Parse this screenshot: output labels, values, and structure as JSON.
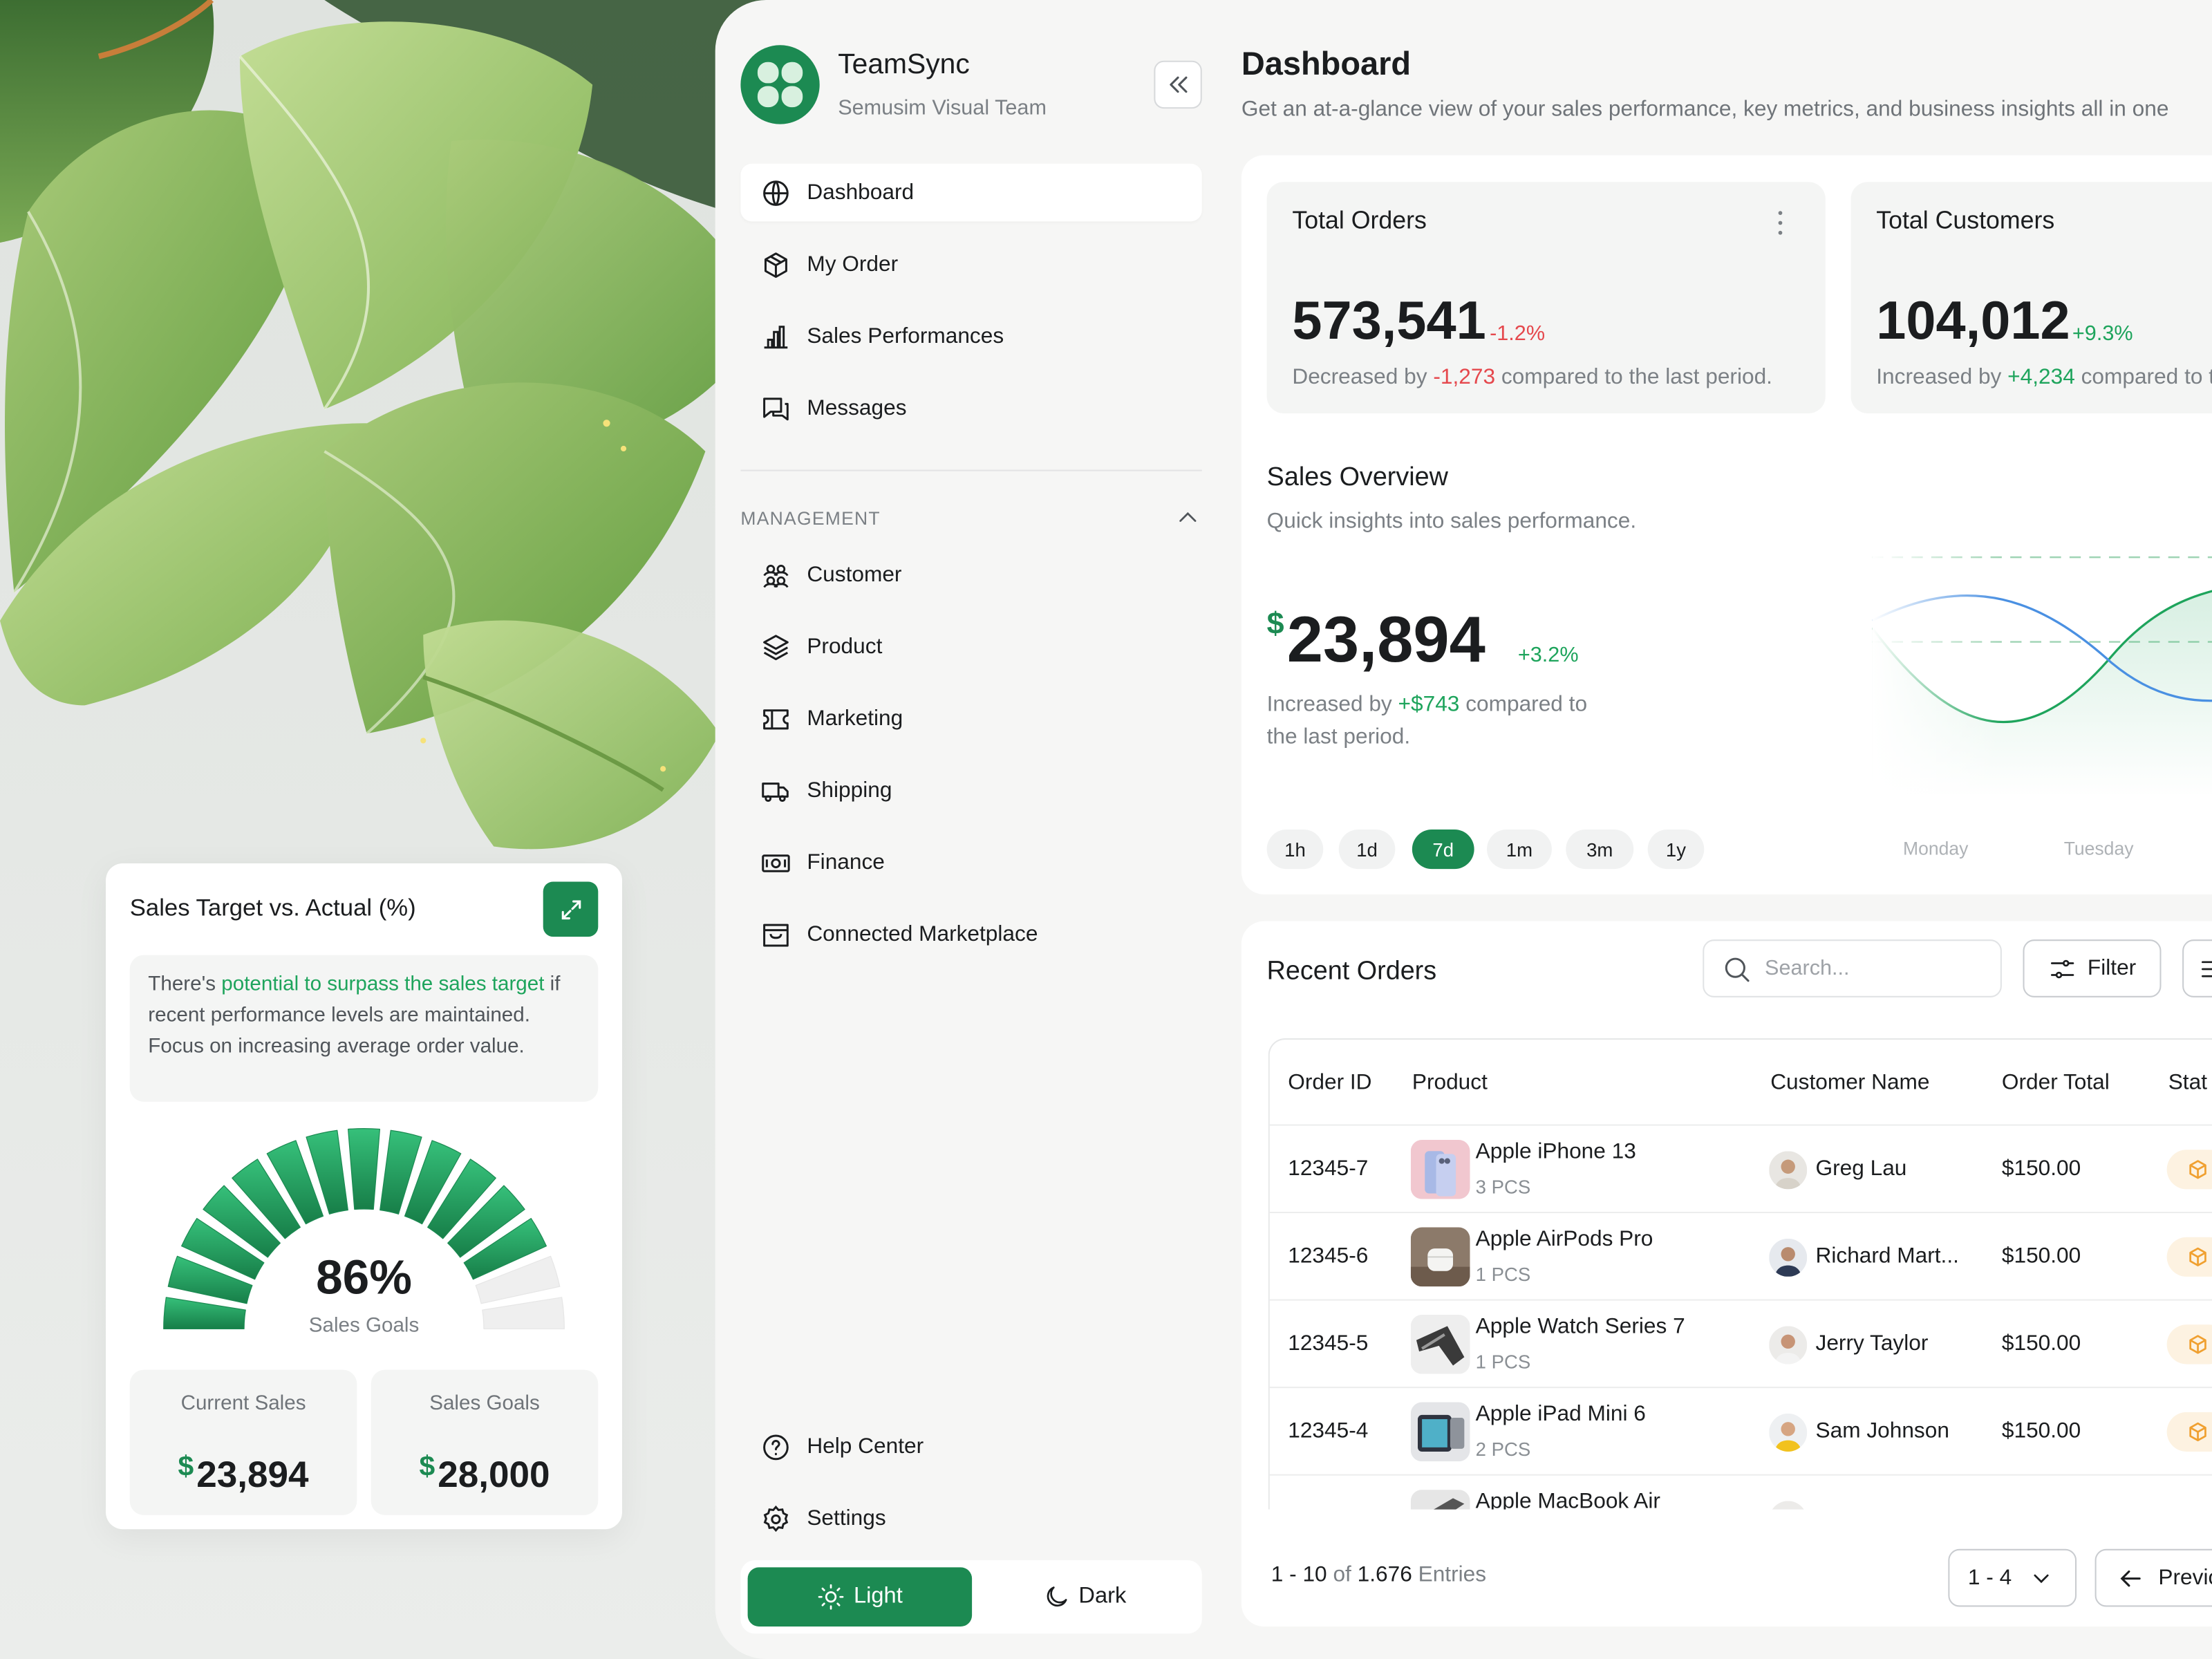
{
  "sales_target_card": {
    "title": "Sales Target vs. Actual (%)",
    "insight_prefix": "There's ",
    "insight_highlight": "potential to surpass the sales target",
    "insight_suffix": " if recent performance levels are maintained. Focus on increasing average order value.",
    "gauge_value": "86%",
    "gauge_percent": 86,
    "gauge_label": "Sales Goals",
    "current_sales_label": "Current Sales",
    "current_sales_currency": "$",
    "current_sales_value": "23,894",
    "sales_goals_label": "Sales Goals",
    "sales_goals_currency": "$",
    "sales_goals_value": "28,000"
  },
  "sidebar": {
    "brand_name": "TeamSync",
    "team_name": "Semusim Visual Team",
    "nav_items": [
      {
        "label": "Dashboard",
        "icon": "globe-icon",
        "active": true
      },
      {
        "label": "My Order",
        "icon": "box-icon"
      },
      {
        "label": "Sales Performances",
        "icon": "bar-chart-icon"
      },
      {
        "label": "Messages",
        "icon": "chat-icon"
      }
    ],
    "section_label": "MANAGEMENT",
    "management_items": [
      {
        "label": "Customer",
        "icon": "users-icon"
      },
      {
        "label": "Product",
        "icon": "layers-icon"
      },
      {
        "label": "Marketing",
        "icon": "ticket-icon"
      },
      {
        "label": "Shipping",
        "icon": "truck-icon"
      },
      {
        "label": "Finance",
        "icon": "money-icon"
      },
      {
        "label": "Connected Marketplace",
        "icon": "store-icon"
      }
    ],
    "help_label": "Help Center",
    "settings_label": "Settings",
    "theme_light": "Light",
    "theme_dark": "Dark"
  },
  "header": {
    "title": "Dashboard",
    "subtitle": "Get an at-a-glance view of your sales performance, key metrics, and business insights all in one"
  },
  "kpis": [
    {
      "title": "Total Orders",
      "value": "573,541",
      "change": "-1.2%",
      "desc_prefix": "Decreased by ",
      "desc_amount": "-1,273",
      "desc_suffix": " compared to the last period."
    },
    {
      "title": "Total Customers",
      "value": "104,012",
      "change": "+9.3%",
      "desc_prefix": "Increased by ",
      "desc_amount": "+4,234",
      "desc_suffix": " compared to the last period."
    }
  ],
  "sales_overview": {
    "title": "Sales Overview",
    "subtitle": "Quick insights into sales performance.",
    "currency": "$",
    "value": "23,894",
    "change": "+3.2%",
    "desc_prefix": "Increased by ",
    "desc_amount": "+$743",
    "desc_suffix": " compared to the last period.",
    "ranges": [
      "1h",
      "1d",
      "7d",
      "1m",
      "3m",
      "1y"
    ],
    "active_range": "7d",
    "days": [
      "Monday",
      "Tuesday"
    ]
  },
  "recent_orders": {
    "title": "Recent Orders",
    "search_placeholder": "Search...",
    "filter_label": "Filter",
    "columns": [
      "Order ID",
      "Product",
      "Customer Name",
      "Order Total",
      "Stat"
    ],
    "rows": [
      {
        "id": "12345-7",
        "product": "Apple iPhone 13",
        "qty": "3 PCS",
        "customer": "Greg Lau",
        "total": "$150.00"
      },
      {
        "id": "12345-6",
        "product": "Apple AirPods Pro",
        "qty": "1 PCS",
        "customer": "Richard Mart...",
        "total": "$150.00"
      },
      {
        "id": "12345-5",
        "product": "Apple Watch Series 7",
        "qty": "1 PCS",
        "customer": "Jerry Taylor",
        "total": "$150.00"
      },
      {
        "id": "12345-4",
        "product": "Apple iPad Mini 6",
        "qty": "2 PCS",
        "customer": "Sam Johnson",
        "total": "$150.00"
      },
      {
        "id": "",
        "product": "Apple MacBook Air",
        "qty": "",
        "customer": "",
        "total": ""
      }
    ],
    "entries_range": "1 - 10",
    "entries_of": " of ",
    "entries_total": "1.676",
    "entries_label": " Entries",
    "page_select": "1 - 4",
    "prev_label": "Previous"
  },
  "colors": {
    "primary": "#1c8a52",
    "positive": "#1ea45c",
    "negative": "#e5484d",
    "status_chip": "#fdf2e1",
    "status_icon": "#f0a030"
  }
}
